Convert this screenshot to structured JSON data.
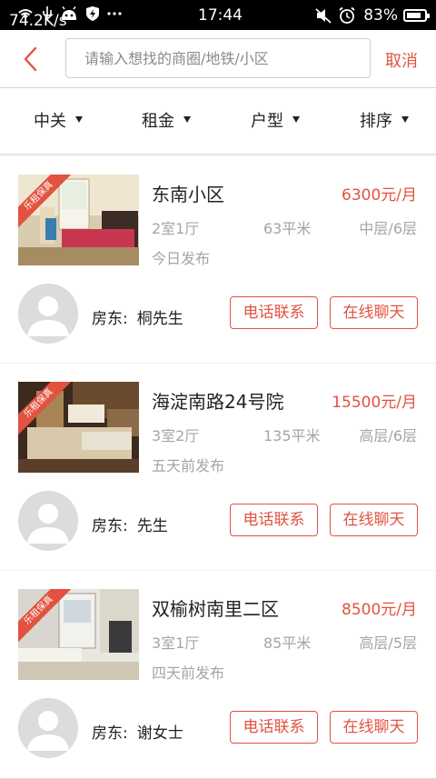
{
  "status_bar": {
    "speed": "74.2K/s",
    "time": "17:44",
    "battery": "83%",
    "battery_level": 0.83,
    "icons": [
      "wifi-icon",
      "usb-icon",
      "android-icon",
      "shield-icon",
      "more-icon",
      "mute-icon",
      "alarm-icon",
      "battery-icon"
    ]
  },
  "search": {
    "placeholder": "请输入想找的商圈/地铁/小区",
    "cancel_label": "取消"
  },
  "filters": [
    {
      "label": "中关"
    },
    {
      "label": "租金"
    },
    {
      "label": "户型"
    },
    {
      "label": "排序"
    }
  ],
  "listings": [
    {
      "badge": "乐租保真",
      "title": "东南小区",
      "price": "6300元/月",
      "rooms": "2室1厅",
      "area": "63平米",
      "floor": "中层/6层",
      "posted": "今日发布",
      "landlord_label": "房东:",
      "landlord_name": "桐先生",
      "call_label": "电话联系",
      "chat_label": "在线聊天"
    },
    {
      "badge": "乐租保真",
      "title": "海淀南路24号院",
      "price": "15500元/月",
      "rooms": "3室2厅",
      "area": "135平米",
      "floor": "高层/6层",
      "posted": "五天前发布",
      "landlord_label": "房东:",
      "landlord_name": "先生",
      "call_label": "电话联系",
      "chat_label": "在线聊天"
    },
    {
      "badge": "乐租保真",
      "title": "双榆树南里二区",
      "price": "8500元/月",
      "rooms": "3室1厅",
      "area": "85平米",
      "floor": "高层/5层",
      "posted": "四天前发布",
      "landlord_label": "房东:",
      "landlord_name": "谢女士",
      "call_label": "电话联系",
      "chat_label": "在线聊天"
    }
  ],
  "colors": {
    "accent": "#e2523f",
    "secondary_text": "#a5a5a5"
  }
}
